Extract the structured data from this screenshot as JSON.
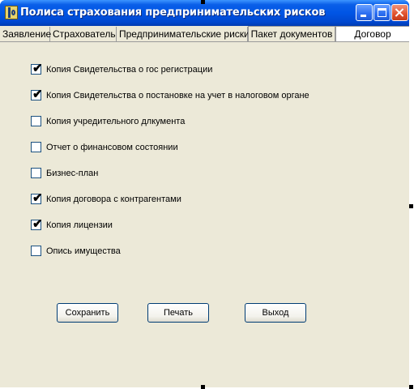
{
  "window": {
    "title": "Полиса страхования предпринимательских рисков"
  },
  "tabs": [
    {
      "label": "Заявление"
    },
    {
      "label": "Страхователь"
    },
    {
      "label": "Предпринимательские риски"
    },
    {
      "label": "Пакет документов"
    },
    {
      "label": "Договор"
    }
  ],
  "active_tab_index": 3,
  "checklist": [
    {
      "label": "Копия Свидетельства о гос регистрации",
      "checked": true
    },
    {
      "label": "Копия Свидетельства о постановке на учет в налоговом органе",
      "checked": true
    },
    {
      "label": "Копия учредительного длкумента",
      "checked": false
    },
    {
      "label": "Отчет о финансовом состоянии",
      "checked": false
    },
    {
      "label": "Бизнес-план",
      "checked": false
    },
    {
      "label": "Копия договора с контрагентами",
      "checked": true
    },
    {
      "label": "Копия лицензии",
      "checked": true
    },
    {
      "label": "Опись имущества",
      "checked": false
    }
  ],
  "buttons": {
    "save": "Сохранить",
    "print": "Печать",
    "exit": "Выход"
  },
  "colors": {
    "titlebar": "#0055e5",
    "panel": "#ece9d8",
    "close_button": "#e0512d"
  }
}
